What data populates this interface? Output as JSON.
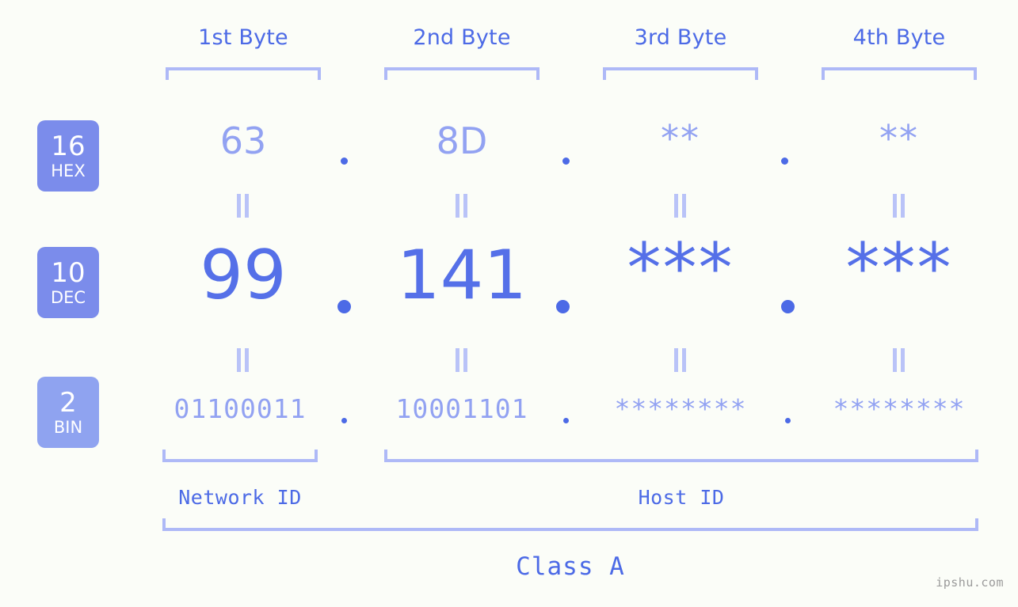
{
  "meta": {
    "background_color": "#fbfdf8",
    "primary_color": "#4c6ae6",
    "light_color": "#92a2f2",
    "bracket_color": "#aeb9f7",
    "badge_color": "#7b8ceb",
    "badge_color_light": "#8fa3f0",
    "watermark": "ipshu.com"
  },
  "columns": [
    {
      "header": "1st Byte"
    },
    {
      "header": "2nd Byte"
    },
    {
      "header": "3rd Byte"
    },
    {
      "header": "4th Byte"
    }
  ],
  "rows": [
    {
      "badge_num": "16",
      "badge_name": "HEX",
      "values": [
        "63",
        "8D",
        "**",
        "**"
      ],
      "separator": "."
    },
    {
      "badge_num": "10",
      "badge_name": "DEC",
      "values": [
        "99",
        "141",
        "***",
        "***"
      ],
      "separator": "."
    },
    {
      "badge_num": "2",
      "badge_name": "BIN",
      "values": [
        "01100011",
        "10001101",
        "********",
        "********"
      ],
      "separator": "."
    }
  ],
  "equality_mark": "=",
  "footer": {
    "network_id_label": "Network ID",
    "host_id_label": "Host ID",
    "class_label": "Class A"
  }
}
